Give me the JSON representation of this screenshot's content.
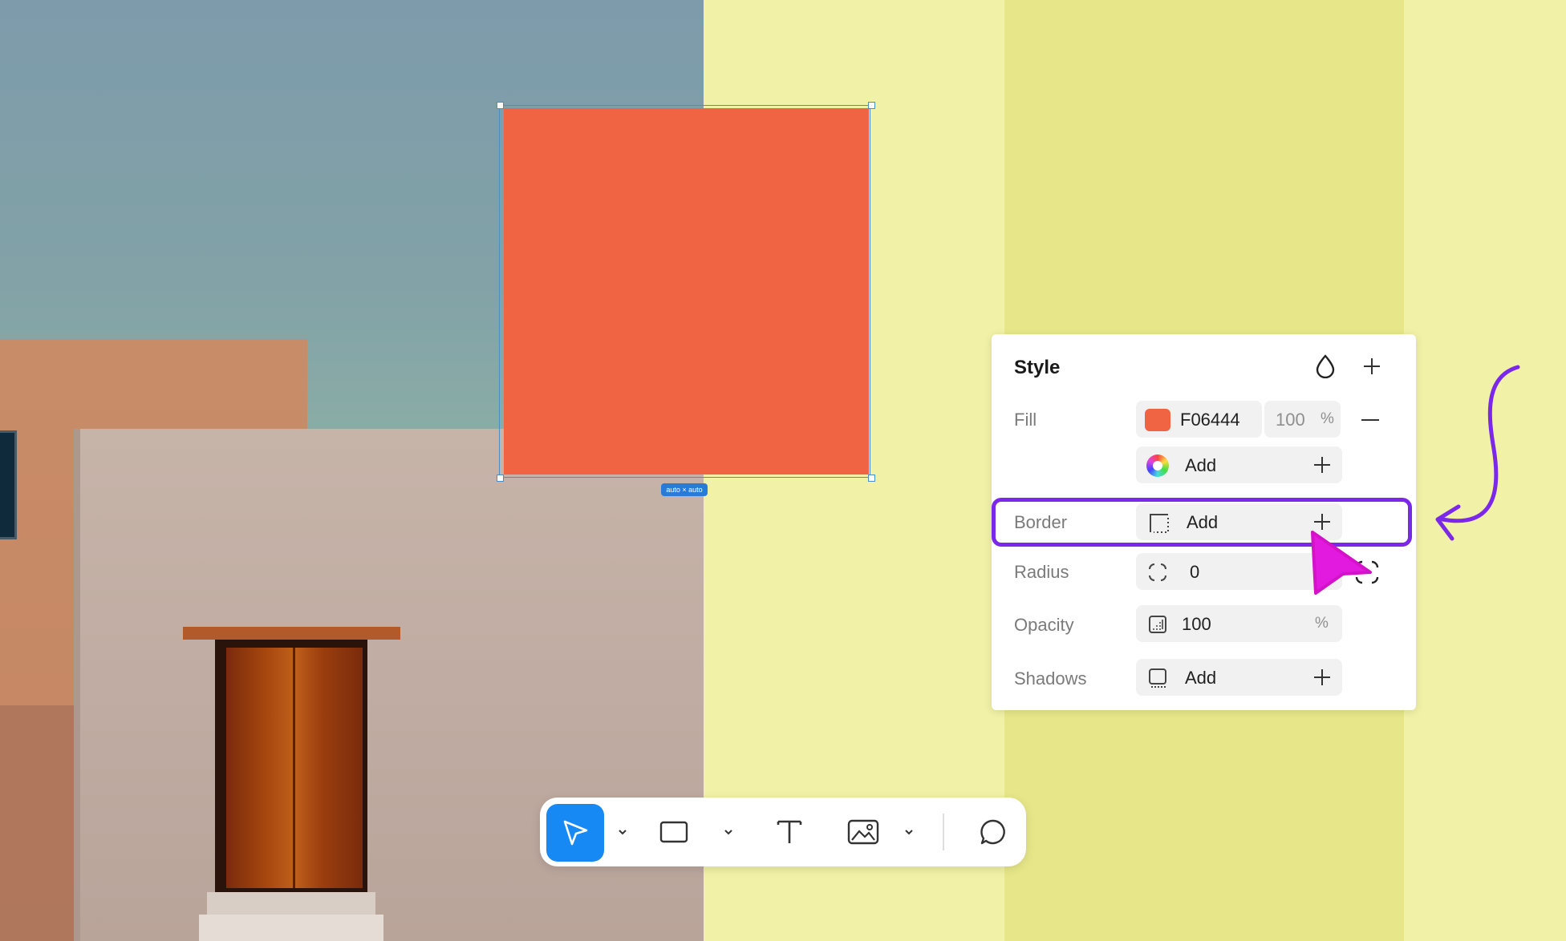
{
  "canvas": {
    "shape_color": "#F06444",
    "size_badge": "auto × auto"
  },
  "style_panel": {
    "title": "Style",
    "fill": {
      "label": "Fill",
      "hex": "F06444",
      "swatch_color": "#F06444",
      "opacity": "100",
      "opacity_unit": "%",
      "add_label": "Add"
    },
    "border": {
      "label": "Border",
      "add_label": "Add"
    },
    "radius": {
      "label": "Radius",
      "value": "0"
    },
    "opacity": {
      "label": "Opacity",
      "value": "100",
      "unit": "%"
    },
    "shadows": {
      "label": "Shadows",
      "add_label": "Add"
    }
  },
  "toolbar": {
    "tools": [
      "select-tool",
      "rectangle-tool",
      "text-tool",
      "image-tool",
      "comment-tool"
    ],
    "active_tool": "select-tool",
    "accent_color": "#1689F5"
  },
  "annotations": {
    "highlight_color": "#7B28E8",
    "cursor_color": "#E21ADF"
  }
}
